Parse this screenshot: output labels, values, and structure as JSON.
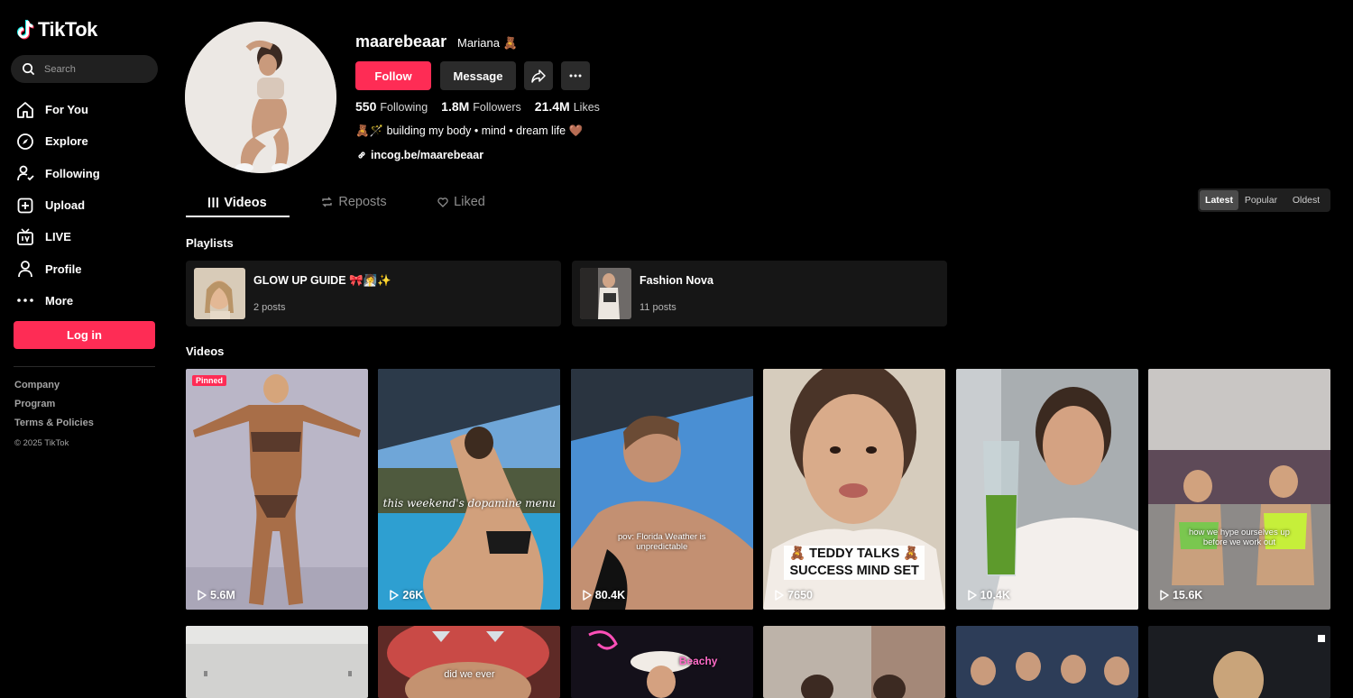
{
  "app": {
    "name": "TikTok"
  },
  "search": {
    "placeholder": "Search"
  },
  "nav": [
    {
      "label": "For You",
      "icon": "home-icon"
    },
    {
      "label": "Explore",
      "icon": "compass-icon"
    },
    {
      "label": "Following",
      "icon": "following-icon"
    },
    {
      "label": "Upload",
      "icon": "upload-icon"
    },
    {
      "label": "LIVE",
      "icon": "live-icon"
    },
    {
      "label": "Profile",
      "icon": "person-icon"
    },
    {
      "label": "More",
      "icon": "more-dots-icon"
    }
  ],
  "login": {
    "label": "Log in"
  },
  "footer": {
    "links": [
      "Company",
      "Program",
      "Terms & Policies"
    ],
    "copyright": "© 2025 TikTok"
  },
  "profile": {
    "username": "maarebeaar",
    "nickname": "Mariana 🧸",
    "follow_label": "Follow",
    "message_label": "Message",
    "stats": [
      {
        "value": "550",
        "label": "Following"
      },
      {
        "value": "1.8M",
        "label": "Followers"
      },
      {
        "value": "21.4M",
        "label": "Likes"
      }
    ],
    "bio": "🧸🪄 building my body • mind • dream life 🤎",
    "link": "incog.be/maarebeaar"
  },
  "tabs": [
    {
      "label": "Videos",
      "icon": "grid-icon"
    },
    {
      "label": "Reposts",
      "icon": "repost-icon"
    },
    {
      "label": "Liked",
      "icon": "heart-icon"
    }
  ],
  "sort": [
    "Latest",
    "Popular",
    "Oldest"
  ],
  "playlists_title": "Playlists",
  "playlists": [
    {
      "title": "GLOW UP GUIDE 🎀🧖‍♀️✨",
      "count": "2 posts"
    },
    {
      "title": "Fashion Nova",
      "count": "11 posts"
    }
  ],
  "videos_title": "Videos",
  "videos": [
    {
      "views": "5.6M",
      "pinned": "Pinned"
    },
    {
      "views": "26K",
      "overlay": "this weekend's dopamine menu"
    },
    {
      "views": "80.4K",
      "overlay": "pov: Florida Weather is unpredictable"
    },
    {
      "views": "7650",
      "caption": [
        "🧸 TEDDY TALKS 🧸",
        "SUCCESS MIND SET"
      ]
    },
    {
      "views": "10.4K"
    },
    {
      "views": "15.6K",
      "overlay": "how we hype ourselves up before we work out"
    }
  ],
  "videos_row2": [
    {
      "overlay": ""
    },
    {
      "overlay": "did we ever"
    },
    {
      "overlay": "Beachy"
    },
    {
      "overlay": ""
    },
    {
      "overlay": ""
    },
    {
      "overlay": ""
    }
  ],
  "colors": {
    "accent": "#fe2c55",
    "background": "#000000",
    "surface": "#161616"
  }
}
